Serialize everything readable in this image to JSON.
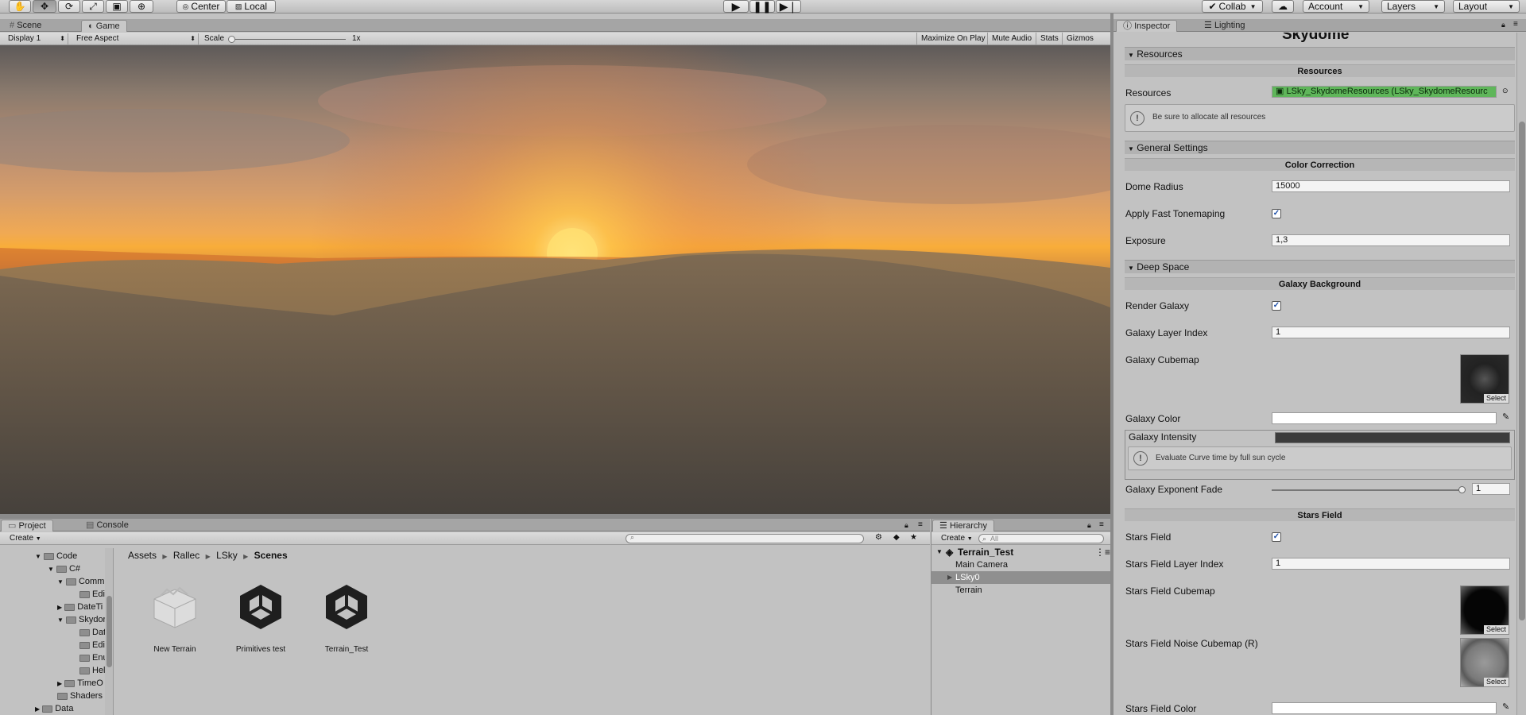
{
  "toolbar": {
    "pivot_center": "Center",
    "pivot_local": "Local",
    "collab": "Collab",
    "account": "Account",
    "layers": "Layers",
    "layout": "Layout"
  },
  "view": {
    "tabs": [
      "Scene",
      "Game"
    ],
    "display": "Display 1",
    "aspect": "Free Aspect",
    "scale_label": "Scale",
    "scale_value": "1x",
    "toggles": [
      "Maximize On Play",
      "Mute Audio",
      "Stats",
      "Gizmos"
    ]
  },
  "inspector": {
    "tabs": [
      "Inspector",
      "Lighting"
    ],
    "title": "Skydome",
    "resources_section": "Resources",
    "resources_band": "Resources",
    "resources_label": "Resources",
    "resources_value": "LSky_SkydomeResources (LSky_SkydomeResourc",
    "resources_help": "Be sure to allocate all resources",
    "general_section": "General Settings",
    "color_band": "Color Correction",
    "dome_radius_label": "Dome Radius",
    "dome_radius_value": "15000",
    "tonemap_label": "Apply Fast Tonemaping",
    "exposure_label": "Exposure",
    "exposure_value": "1,3",
    "deep_space_section": "Deep Space",
    "galaxy_band": "Galaxy Background",
    "render_galaxy_label": "Render Galaxy",
    "galaxy_layer_label": "Galaxy Layer Index",
    "galaxy_layer_value": "1",
    "galaxy_cubemap_label": "Galaxy Cubemap",
    "galaxy_color_label": "Galaxy Color",
    "galaxy_intensity_label": "Galaxy Intensity",
    "galaxy_intensity_help": "Evaluate Curve time by full sun cycle",
    "galaxy_fade_label": "Galaxy Exponent Fade",
    "galaxy_fade_value": "1",
    "stars_band": "Stars Field",
    "stars_field_label": "Stars Field",
    "stars_layer_label": "Stars Field Layer Index",
    "stars_layer_value": "1",
    "stars_cubemap_label": "Stars Field Cubemap",
    "stars_noise_label": "Stars Field Noise Cubemap (R)",
    "stars_color_label": "Stars Field Color",
    "select_label": "Select"
  },
  "project": {
    "tabs": [
      "Project",
      "Console"
    ],
    "create": "Create",
    "breadcrumb": [
      "Assets",
      "Rallec",
      "LSky",
      "Scenes"
    ],
    "tree": [
      "Code",
      "C#",
      "Comm",
      "Edito",
      "DateTi",
      "Skydor",
      "Data",
      "Edito",
      "Enur",
      "Help",
      "TimeO",
      "Shaders",
      "Data"
    ],
    "assets": [
      "New Terrain",
      "Primitives test",
      "Terrain_Test"
    ]
  },
  "hierarchy": {
    "tab": "Hierarchy",
    "create": "Create",
    "search_placeholder": "All",
    "scene": "Terrain_Test",
    "items": [
      "Main Camera",
      "LSky0",
      "Terrain"
    ]
  }
}
